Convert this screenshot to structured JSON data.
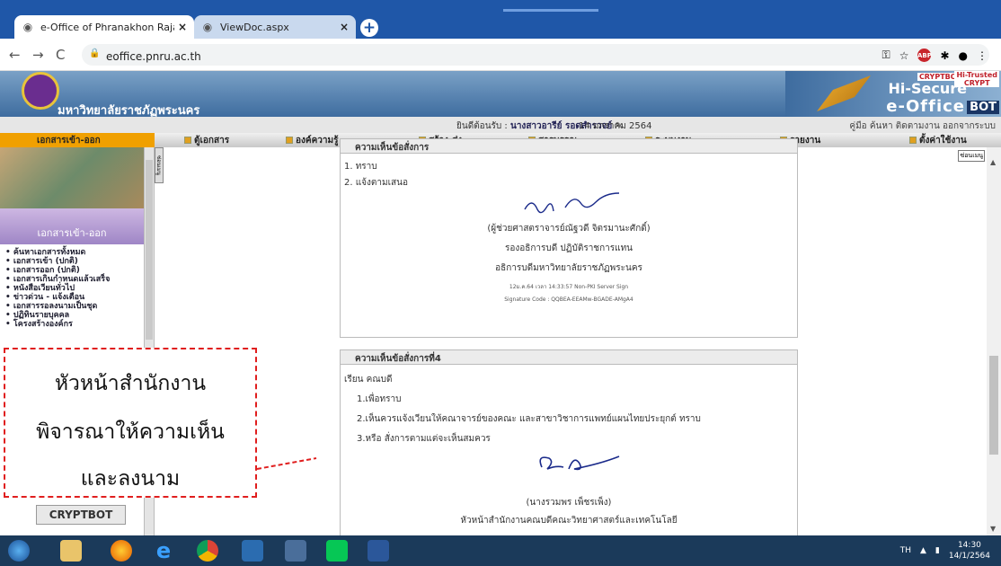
{
  "browser": {
    "tabs": [
      {
        "title": "e-Office of Phranakhon Rajabhat",
        "close": "×"
      },
      {
        "title": "ViewDoc.aspx",
        "close": "×"
      }
    ],
    "new_tab": "+",
    "url": "eoffice.pnru.ac.th"
  },
  "site": {
    "name": "มหาวิทยาลัยราชภัฏพระนคร",
    "brand": {
      "cryptbot": "CRYPTBOT",
      "hi_trusted": "Hi-Trusted",
      "crypt": "CRYPT",
      "hi_secure": "Hi-Secure",
      "eoffice": "e-Office",
      "bot": "BOT"
    },
    "welcome_label": "ยินดีต้อนรับ :",
    "user": "นางสาวอารีย์ รอดสำรวจย์",
    "date": "14 มกราคม 2564",
    "top_links": "คู่มือ ค้นหา ติดตามงาน ออกจากระบบ"
  },
  "menu": [
    "เอกสารเข้า-ออก",
    "ตู้เอกสาร",
    "องค์ความรู้",
    "สร้าง-ส่ง",
    "สารบรรณ",
    "ระบบงาน",
    "รายงาน",
    "ตั้งค่าใช้งาน"
  ],
  "sidebar": {
    "title": "เอกสารเข้า-ออก",
    "tab_label": "ซ่อนเมนู",
    "items": [
      "ค้นหาเอกสารทั้งหมด",
      "เอกสารเข้า (ปกติ)",
      "เอกสารออก (ปกติ)",
      "เอกสารเกินกำหนดแล้วเสร็จ",
      "หนังสือเวียนทั่วไป",
      "ข่าวด่วน - แจ้งเตือน",
      "เอกสารรอลงนามเป็นชุด",
      "ปฏิทินรายบุคคล",
      "โครงสร้างองค์กร"
    ],
    "cryptbot": "CRYPTBOT"
  },
  "content": {
    "hide_menu": "ซ่อนเมนู",
    "panel1": {
      "title": "ความเห็นข้อสั่งการ",
      "lines": [
        "1. ทราบ",
        "2. แจ้งตามเสนอ"
      ],
      "signer": "(ผู้ช่วยศาสตราจารย์ณัฐวดี จิตรมานะศักดิ์)",
      "position1": "รองอธิการบดี ปฏิบัติราชการแทน",
      "position2": "อธิการบดีมหาวิทยาลัยราชภัฏพระนคร",
      "timestamp": "12ม.ค.64 เวลา 14:33:57 Non-PKI Server Sign",
      "code": "Signature Code : QQBEA-EEAMw-BGADE-AMgA4"
    },
    "panel2": {
      "title": "ความเห็นข้อสั่งการที่4",
      "salutation": "เรียน คณบดี",
      "items": [
        "1.เพื่อทราบ",
        "2.เห็นควรแจ้งเวียนให้คณาจารย์ของคณะ และสาขาวิชาการแพทย์แผนไทยประยุกต์ ทราบ",
        "3.หรือ สั่งการตามแต่จะเห็นสมควร"
      ],
      "signer": "(นางรวมพร เพ็ชรเพ็ง)",
      "position": "หัวหน้าสำนักงานคณบดีคณะวิทยาศาสตร์และเทคโนโลยี"
    }
  },
  "annotation": {
    "lines": [
      "หัวหน้าสำนักงาน",
      "พิจารณาให้ความเห็น",
      "และลงนาม"
    ],
    "color": "#e01e1e"
  },
  "taskbar": {
    "lang": "TH",
    "time": "14:30",
    "date": "14/1/2564"
  }
}
